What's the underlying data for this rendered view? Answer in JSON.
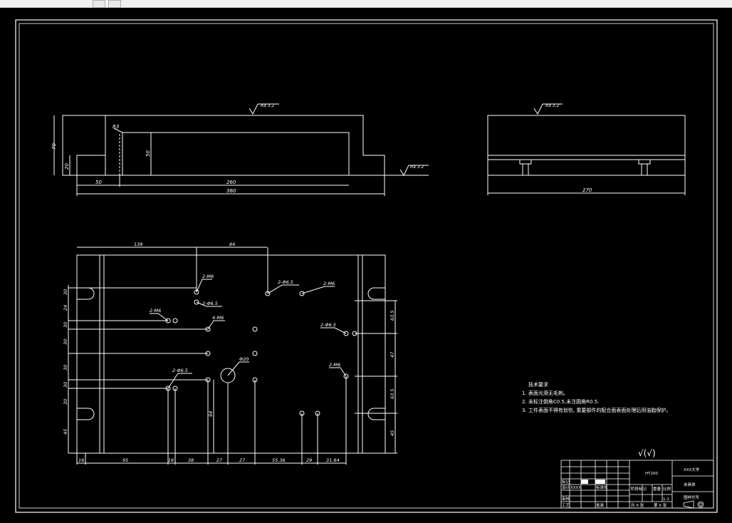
{
  "app": {
    "toolbar_icons": [
      "redo-icon",
      "layer-icon"
    ]
  },
  "drawing": {
    "dims": {
      "top_height_70": "70",
      "top_step_20": "20",
      "top_r3": "R3",
      "top_depth_50": "50",
      "top_left_50": "50",
      "top_inner_260": "260",
      "top_total_360": "360",
      "side_length_270": "270",
      "plan_top_139": "139",
      "plan_top_84": "84",
      "plan_left_dims": [
        "30",
        "24",
        "30",
        "30",
        "30",
        "30",
        "30",
        "45"
      ],
      "plan_right_dims": [
        "63.5",
        "47",
        "63.5",
        "45"
      ],
      "plan_bottom_dims": [
        "16",
        "95",
        "16",
        "38",
        "27",
        "27",
        "55.36",
        "29",
        "31.64"
      ],
      "plan_mid_94": "94"
    },
    "roughness": {
      "top_left": "Ra 3.2",
      "right_end": "Ra 3.2",
      "side_view": "Ra 3.2"
    },
    "hole_callouts": {
      "c1": "2-M6",
      "c2": "2-Φ6.5",
      "c3": "2-Φ6.5",
      "c4": "2-M6",
      "c5": "2-M6",
      "c6": "4-M6",
      "c7": "2-Φ6.5",
      "c8": "Φ20",
      "c9": "2-Φ6.5",
      "c10": "2-M6"
    },
    "tech_req": {
      "title": "技术要求",
      "items": [
        "1. 表面光滑无毛刺。",
        "2. 未标注倒角C0.5,未注圆角R0.5.",
        "3. 工件表面不得有划伤, 重要部件的配合面表面处理后用油脂保护。"
      ]
    },
    "rough_symbol": "√(√)",
    "title_block": {
      "material": "HT200",
      "school": "XXX大学",
      "part_name": "夹具体",
      "drawing_no": "图样代号",
      "scale": "1:1",
      "labels": {
        "mark": "标记",
        "count": "处数",
        "design": "设计",
        "std": "标准化",
        "check": "审核",
        "craft": "工艺",
        "approve": "批准",
        "stage_mark": "阶段标记",
        "weight": "重量",
        "ratio": "比例",
        "sheet_total": "共 X 张",
        "sheet_no": "第 X 张",
        "xxxx": "XXXX"
      }
    }
  }
}
